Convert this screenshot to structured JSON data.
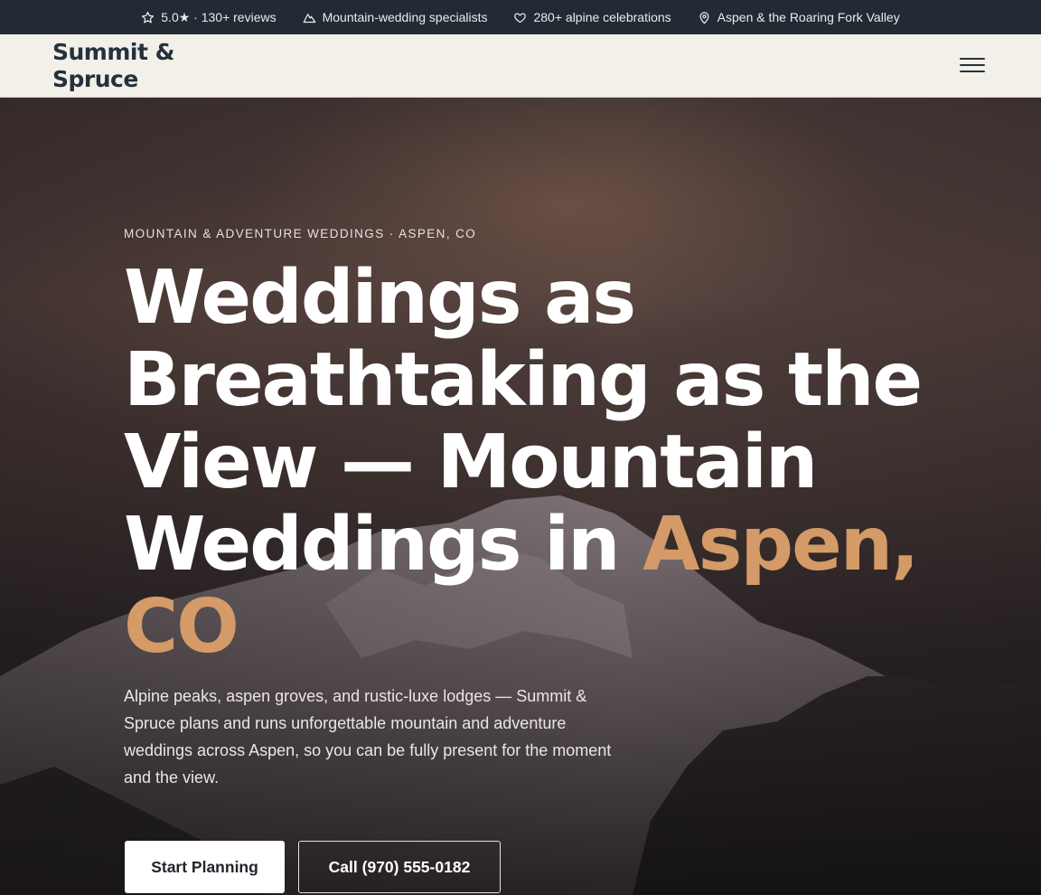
{
  "topbar": {
    "items": [
      {
        "icon": "star-icon",
        "text": "5.0★ · 130+ reviews"
      },
      {
        "icon": "mountain-icon",
        "text": "Mountain-wedding specialists"
      },
      {
        "icon": "heart-icon",
        "text": "280+ alpine celebrations"
      },
      {
        "icon": "location-pin-icon",
        "text": "Aspen & the Roaring Fork Valley"
      }
    ]
  },
  "header": {
    "logo_line1": "Summit &",
    "logo_line2": "Spruce",
    "menu_icon": "hamburger-menu-icon"
  },
  "hero": {
    "eyebrow": "MOUNTAIN & ADVENTURE WEDDINGS · ASPEN, CO",
    "headline_main": "Weddings as Breathtaking as the View — Mountain Weddings in ",
    "headline_accent": "Aspen, CO",
    "subcopy": "Alpine peaks, aspen groves, and rustic-luxe lodges — Summit & Spruce plans and runs unforgettable mountain and adventure weddings across Aspen, so you can be fully present for the moment and the view.",
    "primary_cta": "Start Planning",
    "secondary_cta": "Call (970) 555-0182"
  },
  "colors": {
    "topbar_bg": "#232a33",
    "header_bg": "#f3f0ea",
    "logo": "#25313c",
    "accent": "#d49a68"
  }
}
